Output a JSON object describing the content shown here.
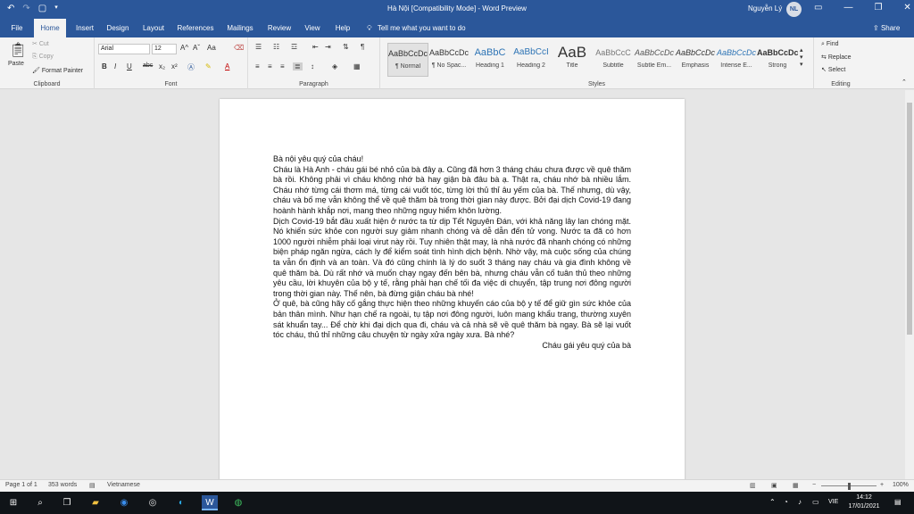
{
  "app": {
    "window_title": "Hà Nội [Compatibility Mode]  -  Word Preview",
    "user_name": "Nguyễn Lý",
    "user_initials": "NL",
    "brand_color": "#2b579a"
  },
  "qat": {
    "undo_icon": "undo-icon",
    "redo_icon": "redo-icon",
    "new_icon": "new-doc-icon",
    "more_icon": "customize-qat-icon"
  },
  "tabs": [
    "File",
    "Home",
    "Insert",
    "Design",
    "Layout",
    "References",
    "Mailings",
    "Review",
    "View",
    "Help"
  ],
  "tell_me": "Tell me what you want to do",
  "share": "Share",
  "ribbon": {
    "clipboard": {
      "paste": "Paste",
      "cut": "Cut",
      "copy": "Copy",
      "format_painter": "Format Painter",
      "label": "Clipboard"
    },
    "font": {
      "font_name": "Arial",
      "font_size": "12",
      "label": "Font",
      "bold": "B",
      "italic": "I",
      "underline": "U",
      "strike": "abc",
      "sub": "x₂",
      "sup": "x²",
      "grow": "A^",
      "shrink": "Aˇ",
      "case": "Aa",
      "color_a": "A"
    },
    "paragraph": {
      "label": "Paragraph"
    },
    "styles": {
      "label": "Styles",
      "items": [
        {
          "sample": "AaBbCcDc",
          "name": "¶ Normal"
        },
        {
          "sample": "AaBbCcDc",
          "name": "¶ No Spac..."
        },
        {
          "sample": "AaBbC",
          "name": "Heading 1"
        },
        {
          "sample": "AaBbCcI",
          "name": "Heading 2"
        },
        {
          "sample": "AaB",
          "name": "Title"
        },
        {
          "sample": "AaBbCcC",
          "name": "Subtitle"
        },
        {
          "sample": "AaBbCcDc",
          "name": "Subtle Em..."
        },
        {
          "sample": "AaBbCcDc",
          "name": "Emphasis"
        },
        {
          "sample": "AaBbCcDc",
          "name": "Intense E..."
        },
        {
          "sample": "AaBbCcDc",
          "name": "Strong"
        }
      ]
    },
    "editing": {
      "label": "Editing",
      "find": "Find",
      "replace": "Replace",
      "select": "Select"
    }
  },
  "document": {
    "title_line": "Bà nội yêu quý của cháu!",
    "p1": "Cháu là Hà Anh - cháu gái bé nhỏ của bà đây ạ. Cũng đã hơn 3 tháng cháu chưa được về quê thăm bà rồi. Không phải vì cháu không nhớ bà hay giận bà đâu bà ạ. Thật ra, cháu nhớ bà nhiều lắm. Cháu nhớ từng cái thơm má, từng cái vuốt tóc, từng lời thủ thỉ âu yếm của bà. Thế nhưng, dù vậy, cháu và bố mẹ vẫn không thể về quê thăm bà trong thời gian này được. Bởi đại dịch Covid-19 đang hoành hành khắp nơi, mang theo những nguy hiểm khôn lường.",
    "p2": "Dịch Covid-19 bắt đầu xuất hiện ở nước ta từ dịp Tết Nguyên Đán, với khả năng lây lan chóng mặt. Nó khiến sức khỏe con người suy giảm nhanh chóng và dễ dẫn đến tử vong. Nước ta đã có hơn 1000 người nhiễm phải loại virut này rồi. Tuy nhiên thật may, là nhà nước đã nhanh chóng có những biện pháp ngăn ngừa, cách ly để kiểm soát tình hình dịch bệnh. Nhờ vậy, mà cuộc sống của chúng ta vẫn ổn định và an toàn. Và đó cũng chính là lý do suốt 3 tháng nay cháu và gia đình không về quê thăm bà. Dù rất nhớ và muốn chạy ngay đến bên bà, nhưng cháu vẫn cố tuân thủ theo những yêu cầu, lời khuyên của bộ y tế, rằng phải hạn chế tối đa việc di chuyển, tập trung nơi đông người trong thời gian này. Thế nên, bà đừng giận cháu bà nhé!",
    "p3": "Ở quê, bà cũng hãy cố gắng thực hiện theo những khuyến cáo của bộ y tế để giữ gìn sức khỏe của bản thân mình. Như hạn chế ra ngoài, tụ tập nơi đông người, luôn mang khẩu trang, thường xuyên sát khuẩn tay...  Để chờ khi đại dịch qua đi, cháu và cả nhà sẽ về quê thăm bà ngay. Bà sẽ lại vuốt tóc cháu, thủ thỉ những câu chuyện từ ngày xửa ngày xưa. Bà nhé?",
    "signature": "Cháu gái yêu quý của bà"
  },
  "status": {
    "page": "Page 1 of 1",
    "words": "353 words",
    "language": "Vietnamese",
    "zoom": "100%"
  },
  "taskbar": {
    "time": "14:12",
    "date": "17/01/2021",
    "lang": "VIE"
  }
}
